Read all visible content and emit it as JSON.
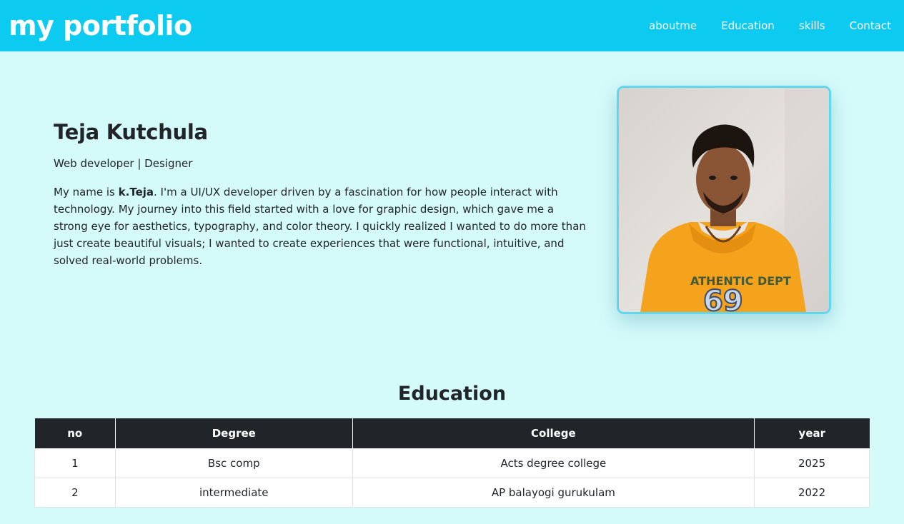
{
  "navbar": {
    "brand": "my portfolio",
    "links": [
      "aboutme",
      "Education",
      "skills",
      "Contact"
    ]
  },
  "hero": {
    "name": "Teja Kutchula",
    "subtitle": "Web developer | Designer",
    "bio_prefix": "My name is ",
    "bio_bold": "k.Teja",
    "bio_rest": ". I'm a UI/UX developer driven by a fascination for how people interact with technology. My journey into this field started with a love for graphic design, which gave me a strong eye for aesthetics, typography, and color theory. I quickly realized I wanted to do more than just create beautiful visuals; I wanted to create experiences that were functional, intuitive, and solved real-world problems."
  },
  "education": {
    "title": "Education",
    "headers": [
      "no",
      "Degree",
      "College",
      "year"
    ],
    "rows": [
      [
        "1",
        "Bsc comp",
        "Acts degree college",
        "2025"
      ],
      [
        "2",
        "intermediate",
        "AP balayogi gurukulam",
        "2022"
      ]
    ]
  },
  "colors": {
    "navbar": "#0dcaf0",
    "page_background": "#d5fafa",
    "table_header": "#212529",
    "photo_border": "#5ed7f0"
  }
}
